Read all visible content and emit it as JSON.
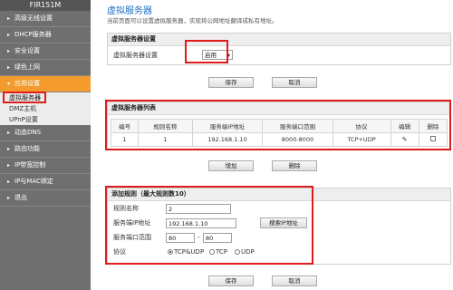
{
  "brand": "FIR151M",
  "sidebar": {
    "items": [
      {
        "label": "高级无线设置"
      },
      {
        "label": "DHCP服务器"
      },
      {
        "label": "安全设置"
      },
      {
        "label": "绿色上网"
      },
      {
        "label": "应用设置",
        "active": true
      },
      {
        "label": "动态DNS"
      },
      {
        "label": "路由功能"
      },
      {
        "label": "IP带宽控制"
      },
      {
        "label": "IP与MAC绑定"
      },
      {
        "label": "退出"
      }
    ],
    "sub_items": [
      {
        "label": "虚拟服务器"
      },
      {
        "label": "DMZ主机"
      },
      {
        "label": "UPnP设置"
      }
    ]
  },
  "page": {
    "title": "虚拟服务器",
    "desc": "当前页面可以设置虚拟服务器，实现将公网地址翻译成私有地址。"
  },
  "vs_settings": {
    "header": "虚拟服务器设置",
    "label": "虚拟服务器设置",
    "value": "启用",
    "save": "保存",
    "cancel": "取消"
  },
  "vs_list": {
    "header": "虚拟服务器列表",
    "columns": [
      "编号",
      "规则名称",
      "服务端IP地址",
      "服务端口范围",
      "协议",
      "编辑",
      "删除"
    ],
    "rows": [
      {
        "no": "1",
        "name": "1",
        "ip": "192.168.1.10",
        "ports": "8000-8000",
        "proto": "TCP+UDP"
      }
    ],
    "add": "增加",
    "delete": "删除"
  },
  "add_rule": {
    "header": "添加规则（最大规则数10）",
    "name_label": "规则名称",
    "name_value": "2",
    "ip_label": "服务端IP地址",
    "ip_value": "192.168.1.10",
    "search_ip": "搜索IP地址",
    "port_label": "服务端口范围",
    "port_from": "80",
    "port_sep": "-",
    "port_to": "80",
    "proto_label": "协议",
    "proto_options": [
      "TCP&UDP",
      "TCP",
      "UDP"
    ],
    "proto_selected": "TCP&UDP",
    "save": "保存",
    "cancel": "取消"
  },
  "colors": {
    "accent": "#f39b2c",
    "sidebar": "#6f6f6f",
    "highlight": "#e01b1b",
    "title": "#1e6fbd"
  }
}
